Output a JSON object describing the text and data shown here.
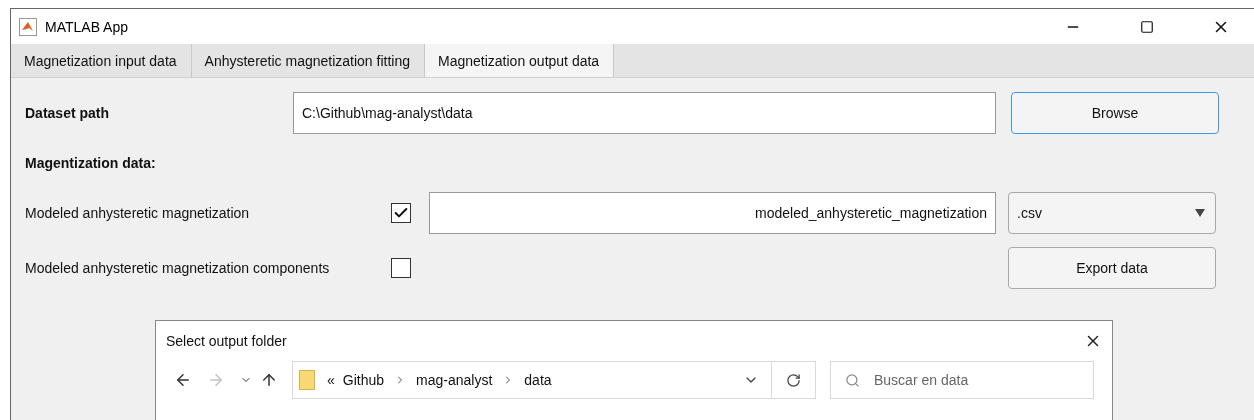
{
  "window": {
    "title": "MATLAB App"
  },
  "tabs": [
    {
      "label": "Magnetization input data",
      "selected": false
    },
    {
      "label": "Anhysteretic magnetization fitting",
      "selected": false
    },
    {
      "label": "Magnetization output data",
      "selected": true
    }
  ],
  "dataset": {
    "label": "Dataset path",
    "value": "C:\\Github\\mag-analyst\\data",
    "button": "Browse"
  },
  "section_title": "Magentization data:",
  "outputs": [
    {
      "label": "Modeled anhysteretic magnetization",
      "checked": true,
      "filename": "modeled_anhysteretic_magnetization",
      "format": ".csv"
    },
    {
      "label": "Modeled anhysteretic magnetization components",
      "checked": false,
      "button": "Export data"
    }
  ],
  "dialog": {
    "title": "Select output folder",
    "forward_disabled": true,
    "overflow": "«",
    "path": [
      "Github",
      "mag-analyst",
      "data"
    ],
    "search_placeholder": "Buscar en data"
  }
}
